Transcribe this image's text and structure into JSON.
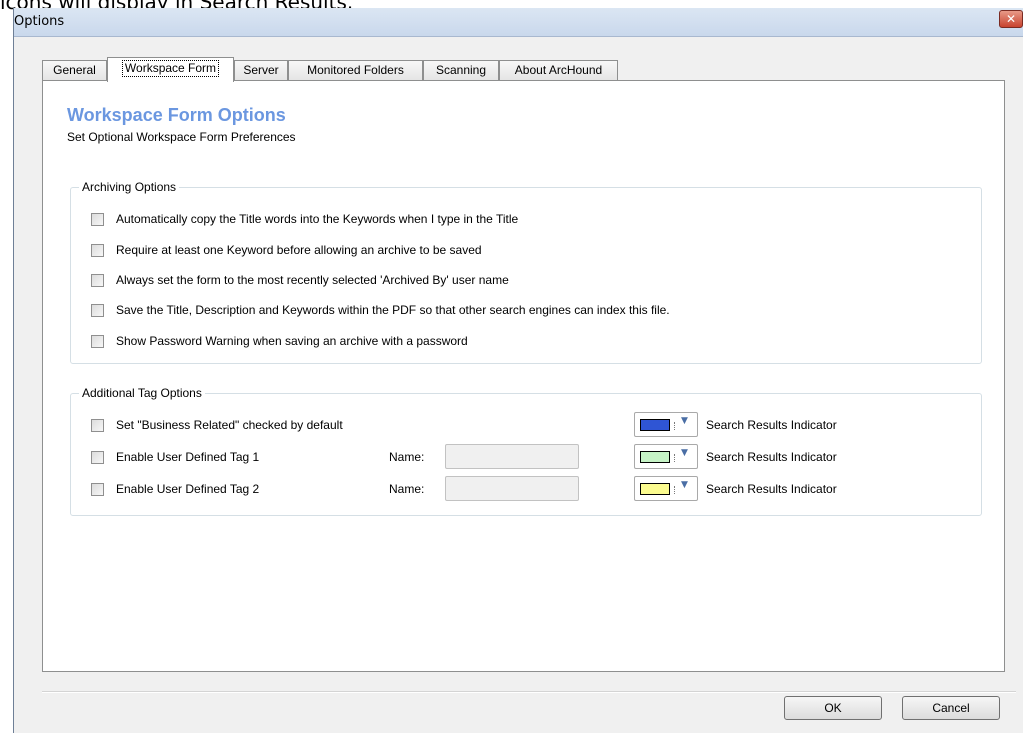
{
  "background_text": "icons will display in Search Results.",
  "window": {
    "title": "Options",
    "close_glyph": "✕"
  },
  "tabs": [
    {
      "label": "General",
      "active": false
    },
    {
      "label": "Workspace Form",
      "active": true
    },
    {
      "label": "Server",
      "active": false
    },
    {
      "label": "Monitored Folders",
      "active": false
    },
    {
      "label": "Scanning",
      "active": false
    },
    {
      "label": "About ArcHound",
      "active": false
    }
  ],
  "form": {
    "heading": "Workspace Form Options",
    "subheading": "Set Optional Workspace Form Preferences"
  },
  "archiving": {
    "title": "Archiving Options",
    "options": [
      {
        "label": "Automatically copy the Title words into the Keywords when I type in the Title",
        "checked": false
      },
      {
        "label": "Require at least one Keyword before allowing an archive to be saved",
        "checked": false
      },
      {
        "label": "Always set the form to the most recently selected 'Archived By' user name",
        "checked": false
      },
      {
        "label": "Save the Title, Description and Keywords within the PDF so that other search engines can index this file.",
        "checked": false
      },
      {
        "label": "Show Password Warning when saving an archive with a password",
        "checked": false
      }
    ]
  },
  "tags": {
    "title": "Additional Tag Options",
    "rows": [
      {
        "label": "Set \"Business Related\" checked by default",
        "checked": false,
        "color": "#2f55d4",
        "indicator": "Search Results Indicator"
      },
      {
        "label": "Enable User Defined Tag 1",
        "checked": false,
        "name_label": "Name:",
        "name_value": "",
        "color": "#c6f3c6",
        "indicator": "Search Results Indicator"
      },
      {
        "label": "Enable User Defined Tag 2",
        "checked": false,
        "name_label": "Name:",
        "name_value": "",
        "color": "#fbfb8f",
        "indicator": "Search Results Indicator"
      }
    ]
  },
  "buttons": {
    "ok": "OK",
    "cancel": "Cancel"
  },
  "icons": {
    "checkbox": "checkbox-icon",
    "dropdown": "chevron-down-icon",
    "close": "close-icon"
  }
}
